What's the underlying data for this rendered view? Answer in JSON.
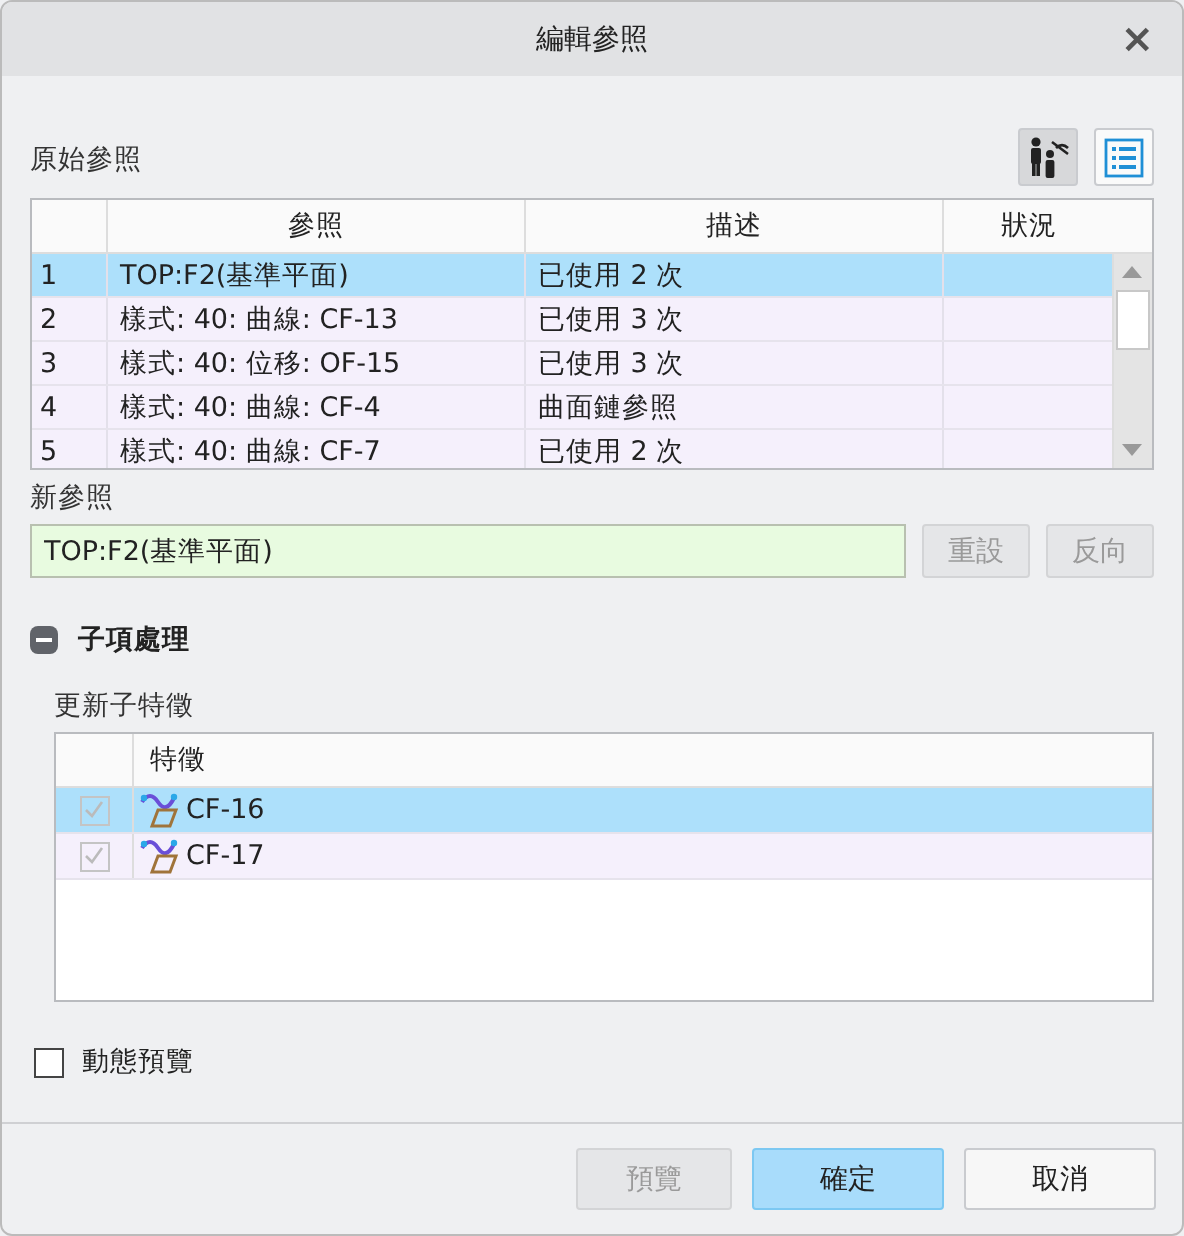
{
  "window": {
    "title": "編輯參照",
    "close": "×"
  },
  "original_references": {
    "label": "原始參照",
    "tools": [
      {
        "kind": "people",
        "pressed": true
      },
      {
        "kind": "list",
        "pressed": false
      }
    ],
    "columns": [
      "參照",
      "描述",
      "狀況"
    ],
    "rows": [
      {
        "index": "1",
        "reference": "TOP:F2(基準平面)",
        "description": "已使用 2 次",
        "selected": true
      },
      {
        "index": "2",
        "reference": "樣式: 40: 曲線: CF-13",
        "description": "已使用 3 次",
        "selected": false
      },
      {
        "index": "3",
        "reference": "樣式: 40: 位移: OF-15",
        "description": "已使用 3 次",
        "selected": false
      },
      {
        "index": "4",
        "reference": "樣式: 40: 曲線: CF-4",
        "description": "曲面鏈參照",
        "selected": false
      },
      {
        "index": "5",
        "reference": "樣式: 40: 曲線: CF-7",
        "description": "已使用 2 次",
        "selected": false
      }
    ]
  },
  "new_reference": {
    "label": "新參照",
    "value": "TOP:F2(基準平面)",
    "buttons": [
      {
        "label": "重設",
        "disabled": true
      },
      {
        "label": "反向",
        "disabled": true
      }
    ]
  },
  "child_handling": {
    "title": "子項處理",
    "expanded": true,
    "subtitle": "更新子特徵",
    "column": "特徵",
    "rows": [
      {
        "name": "CF-16",
        "checked": true,
        "disabled": true,
        "selected": true
      },
      {
        "name": "CF-17",
        "checked": true,
        "disabled": true,
        "selected": false
      }
    ]
  },
  "dynamic_preview": {
    "label": "動態預覽",
    "checked": false
  },
  "footer_buttons": [
    {
      "label": "預覽",
      "kind": "secondary",
      "disabled": true
    },
    {
      "label": "確定",
      "kind": "primary",
      "disabled": false
    },
    {
      "label": "取消",
      "kind": "default",
      "disabled": false
    }
  ]
}
